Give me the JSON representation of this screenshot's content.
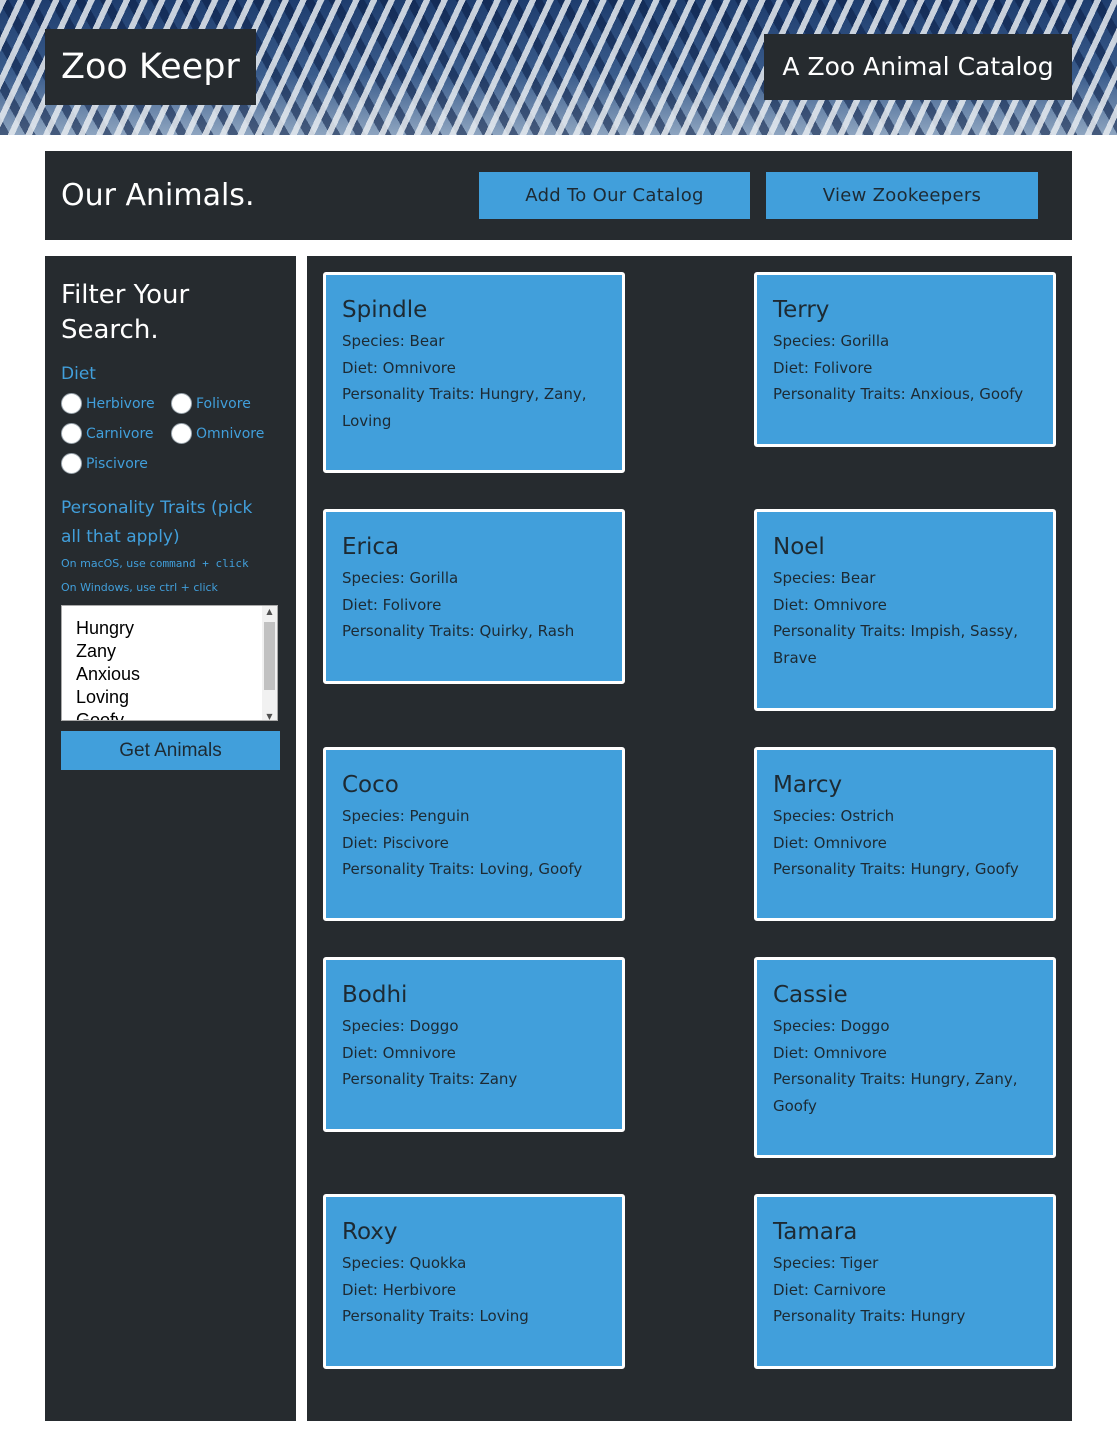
{
  "header": {
    "brand": "Zoo Keepr",
    "tagline": "A Zoo Animal Catalog"
  },
  "titlebar": {
    "title": "Our Animals.",
    "add_label": "Add To Our Catalog",
    "keepers_label": "View Zookeepers"
  },
  "filter": {
    "title": "Filter Your Search.",
    "diet_label": "Diet",
    "diets": [
      "Herbivore",
      "Folivore",
      "Carnivore",
      "Omnivore",
      "Piscivore"
    ],
    "traits_label": "Personality Traits (pick all that apply)",
    "hint_mac_prefix": "On macOS, use ",
    "hint_mac_keys": "command + click",
    "hint_windows": "On Windows, use ctrl + click",
    "trait_options": [
      "Hungry",
      "Zany",
      "Anxious",
      "Loving",
      "Goofy"
    ],
    "get_label": "Get Animals"
  },
  "animals": [
    {
      "name": "Spindle",
      "species": "Species: Bear",
      "diet": "Diet: Omnivore",
      "traits": "Personality Traits: Hungry, Zany, Loving"
    },
    {
      "name": "Terry",
      "species": "Species: Gorilla",
      "diet": "Diet: Folivore",
      "traits": "Personality Traits: Anxious, Goofy"
    },
    {
      "name": "Erica",
      "species": "Species: Gorilla",
      "diet": "Diet: Folivore",
      "traits": "Personality Traits: Quirky, Rash"
    },
    {
      "name": "Noel",
      "species": "Species: Bear",
      "diet": "Diet: Omnivore",
      "traits": "Personality Traits: Impish, Sassy, Brave"
    },
    {
      "name": "Coco",
      "species": "Species: Penguin",
      "diet": "Diet: Piscivore",
      "traits": "Personality Traits: Loving, Goofy"
    },
    {
      "name": "Marcy",
      "species": "Species: Ostrich",
      "diet": "Diet: Omnivore",
      "traits": "Personality Traits: Hungry, Goofy"
    },
    {
      "name": "Bodhi",
      "species": "Species: Doggo",
      "diet": "Diet: Omnivore",
      "traits": "Personality Traits: Zany"
    },
    {
      "name": "Cassie",
      "species": "Species: Doggo",
      "diet": "Diet: Omnivore",
      "traits": "Personality Traits: Hungry, Zany, Goofy"
    },
    {
      "name": "Roxy",
      "species": "Species: Quokka",
      "diet": "Diet: Herbivore",
      "traits": "Personality Traits: Loving"
    },
    {
      "name": "Tamara",
      "species": "Species: Tiger",
      "diet": "Diet: Carnivore",
      "traits": "Personality Traits: Hungry"
    }
  ],
  "colors": {
    "dark_panel": "#262b2f",
    "accent": "#419fdb",
    "card_text": "#1d2a33"
  }
}
